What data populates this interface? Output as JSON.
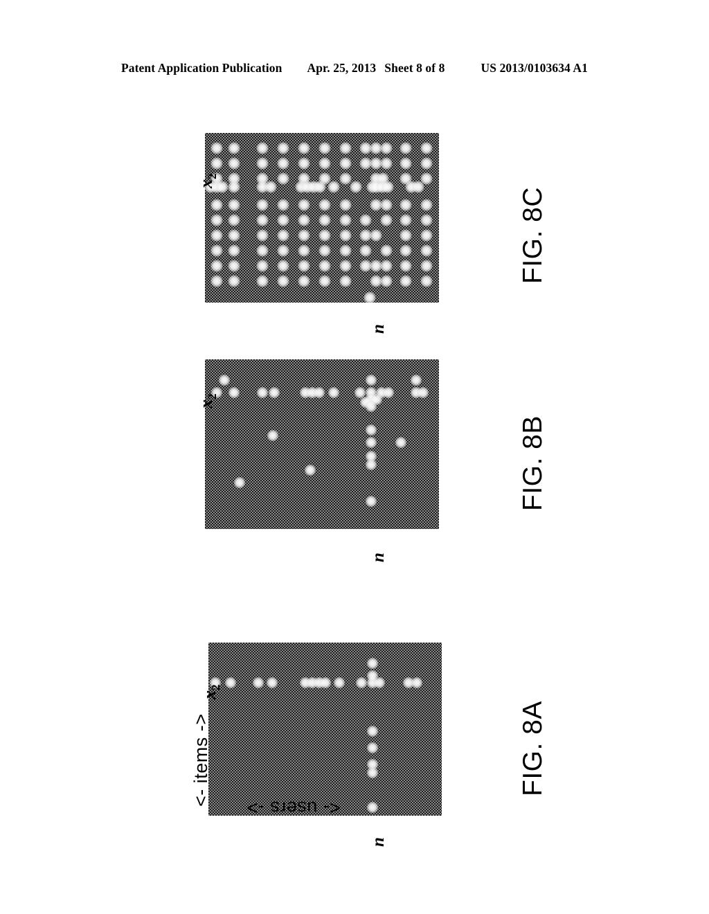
{
  "header": {
    "publication": "Patent Application Publication",
    "date": "Apr. 25, 2013",
    "sheet": "Sheet 8 of 8",
    "patent_number": "US 2013/0103634 A1"
  },
  "figures": [
    {
      "id": "fig-8c",
      "caption": "FIG. 8C",
      "axis_vertical_label": "x2",
      "axis_vertical_label_base": "x",
      "axis_vertical_label_sub": "2",
      "axis_horizontal_label": "n"
    },
    {
      "id": "fig-8b",
      "caption": "FIG. 8B",
      "axis_vertical_label": "x2",
      "axis_vertical_label_base": "x",
      "axis_vertical_label_sub": "2",
      "axis_horizontal_label": "n"
    },
    {
      "id": "fig-8a",
      "caption": "FIG. 8A",
      "axis_vertical_label": "x2",
      "axis_vertical_label_base": "x",
      "axis_vertical_label_sub": "2",
      "axis_horizontal_label": "n",
      "axis_items_label": "<- items ->",
      "axis_users_label": "<- users ->"
    }
  ],
  "colors": {
    "panel_background": "#8a8a8a",
    "panel_dither_dark": "#1c1c1c",
    "dot": "#ffffff",
    "text": "#000000",
    "page": "#ffffff"
  },
  "chart_data": [
    {
      "type": "scatter",
      "title": "FIG. 8C",
      "xlabel": "n",
      "ylabel": "x2",
      "description": "Dense matrix of observed user-item entries; nearly fully sampled grid.",
      "xlim": [
        0,
        338
      ],
      "ylim": [
        0,
        245
      ],
      "grid": false,
      "points": [
        [
          17,
          22
        ],
        [
          42,
          22
        ],
        [
          83,
          22
        ],
        [
          113,
          22
        ],
        [
          143,
          22
        ],
        [
          173,
          22
        ],
        [
          203,
          22
        ],
        [
          232,
          22
        ],
        [
          247,
          22
        ],
        [
          262,
          22
        ],
        [
          290,
          22
        ],
        [
          320,
          22
        ],
        [
          17,
          44
        ],
        [
          42,
          44
        ],
        [
          83,
          44
        ],
        [
          113,
          44
        ],
        [
          143,
          44
        ],
        [
          173,
          44
        ],
        [
          203,
          44
        ],
        [
          232,
          44
        ],
        [
          247,
          44
        ],
        [
          262,
          44
        ],
        [
          290,
          44
        ],
        [
          320,
          44
        ],
        [
          17,
          66
        ],
        [
          42,
          66
        ],
        [
          83,
          66
        ],
        [
          113,
          66
        ],
        [
          143,
          66
        ],
        [
          173,
          66
        ],
        [
          203,
          66
        ],
        [
          247,
          66
        ],
        [
          257,
          66
        ],
        [
          290,
          66
        ],
        [
          320,
          66
        ],
        [
          8,
          78
        ],
        [
          17,
          78
        ],
        [
          25,
          78
        ],
        [
          42,
          78
        ],
        [
          83,
          78
        ],
        [
          95,
          78
        ],
        [
          139,
          78
        ],
        [
          148,
          78
        ],
        [
          157,
          78
        ],
        [
          166,
          78
        ],
        [
          186,
          78
        ],
        [
          218,
          78
        ],
        [
          242,
          78
        ],
        [
          248,
          78
        ],
        [
          256,
          78
        ],
        [
          264,
          78
        ],
        [
          298,
          78
        ],
        [
          308,
          78
        ],
        [
          17,
          104
        ],
        [
          42,
          104
        ],
        [
          83,
          104
        ],
        [
          113,
          104
        ],
        [
          143,
          104
        ],
        [
          173,
          104
        ],
        [
          203,
          104
        ],
        [
          247,
          104
        ],
        [
          262,
          104
        ],
        [
          290,
          104
        ],
        [
          320,
          104
        ],
        [
          17,
          126
        ],
        [
          42,
          126
        ],
        [
          83,
          126
        ],
        [
          113,
          126
        ],
        [
          143,
          126
        ],
        [
          173,
          126
        ],
        [
          203,
          126
        ],
        [
          232,
          126
        ],
        [
          262,
          126
        ],
        [
          290,
          126
        ],
        [
          320,
          126
        ],
        [
          17,
          148
        ],
        [
          42,
          148
        ],
        [
          83,
          148
        ],
        [
          113,
          148
        ],
        [
          143,
          148
        ],
        [
          173,
          148
        ],
        [
          203,
          148
        ],
        [
          232,
          148
        ],
        [
          247,
          148
        ],
        [
          290,
          148
        ],
        [
          320,
          148
        ],
        [
          17,
          170
        ],
        [
          42,
          170
        ],
        [
          83,
          170
        ],
        [
          113,
          170
        ],
        [
          143,
          170
        ],
        [
          173,
          170
        ],
        [
          203,
          170
        ],
        [
          232,
          170
        ],
        [
          262,
          170
        ],
        [
          290,
          170
        ],
        [
          320,
          170
        ],
        [
          17,
          192
        ],
        [
          42,
          192
        ],
        [
          83,
          192
        ],
        [
          113,
          192
        ],
        [
          143,
          192
        ],
        [
          173,
          192
        ],
        [
          203,
          192
        ],
        [
          232,
          192
        ],
        [
          247,
          192
        ],
        [
          262,
          192
        ],
        [
          290,
          192
        ],
        [
          320,
          192
        ],
        [
          17,
          214
        ],
        [
          42,
          214
        ],
        [
          83,
          214
        ],
        [
          113,
          214
        ],
        [
          143,
          214
        ],
        [
          173,
          214
        ],
        [
          203,
          214
        ],
        [
          247,
          214
        ],
        [
          262,
          214
        ],
        [
          290,
          214
        ],
        [
          320,
          214
        ],
        [
          238,
          238
        ]
      ]
    },
    {
      "type": "scatter",
      "title": "FIG. 8B",
      "xlabel": "n",
      "ylabel": "x2",
      "description": "Partially sampled matrix; the cross-shaped active row/column plus a handful of scattered observations.",
      "xlim": [
        0,
        338
      ],
      "ylim": [
        0,
        245
      ],
      "grid": false,
      "points": [
        [
          28,
          30
        ],
        [
          240,
          30
        ],
        [
          305,
          30
        ],
        [
          17,
          48
        ],
        [
          42,
          48
        ],
        [
          83,
          48
        ],
        [
          100,
          48
        ],
        [
          145,
          48
        ],
        [
          155,
          48
        ],
        [
          165,
          48
        ],
        [
          186,
          48
        ],
        [
          224,
          48
        ],
        [
          240,
          48
        ],
        [
          255,
          48
        ],
        [
          265,
          48
        ],
        [
          305,
          48
        ],
        [
          315,
          48
        ],
        [
          240,
          58
        ],
        [
          248,
          58
        ],
        [
          232,
          62
        ],
        [
          240,
          68
        ],
        [
          240,
          102
        ],
        [
          240,
          120
        ],
        [
          283,
          120
        ],
        [
          240,
          140
        ],
        [
          240,
          152
        ],
        [
          98,
          110
        ],
        [
          152,
          160
        ],
        [
          50,
          178
        ],
        [
          240,
          205
        ]
      ]
    },
    {
      "type": "scatter",
      "title": "FIG. 8A",
      "xlabel": "n",
      "ylabel": "x2",
      "axis_items_label": "<- items ->",
      "axis_users_label": "<- users ->",
      "description": "Sparse matrix showing a single active row and a single active column (cross pattern) of observed entries.",
      "xlim": [
        0,
        338
      ],
      "ylim": [
        0,
        250
      ],
      "grid": false,
      "points": [
        [
          238,
          30
        ],
        [
          10,
          58
        ],
        [
          32,
          58
        ],
        [
          72,
          58
        ],
        [
          92,
          58
        ],
        [
          140,
          58
        ],
        [
          150,
          58
        ],
        [
          160,
          58
        ],
        [
          170,
          58
        ],
        [
          190,
          58
        ],
        [
          222,
          58
        ],
        [
          238,
          58
        ],
        [
          248,
          58
        ],
        [
          238,
          48
        ],
        [
          290,
          58
        ],
        [
          302,
          58
        ],
        [
          238,
          128
        ],
        [
          238,
          152
        ],
        [
          238,
          176
        ],
        [
          238,
          188
        ],
        [
          238,
          238
        ]
      ]
    }
  ]
}
